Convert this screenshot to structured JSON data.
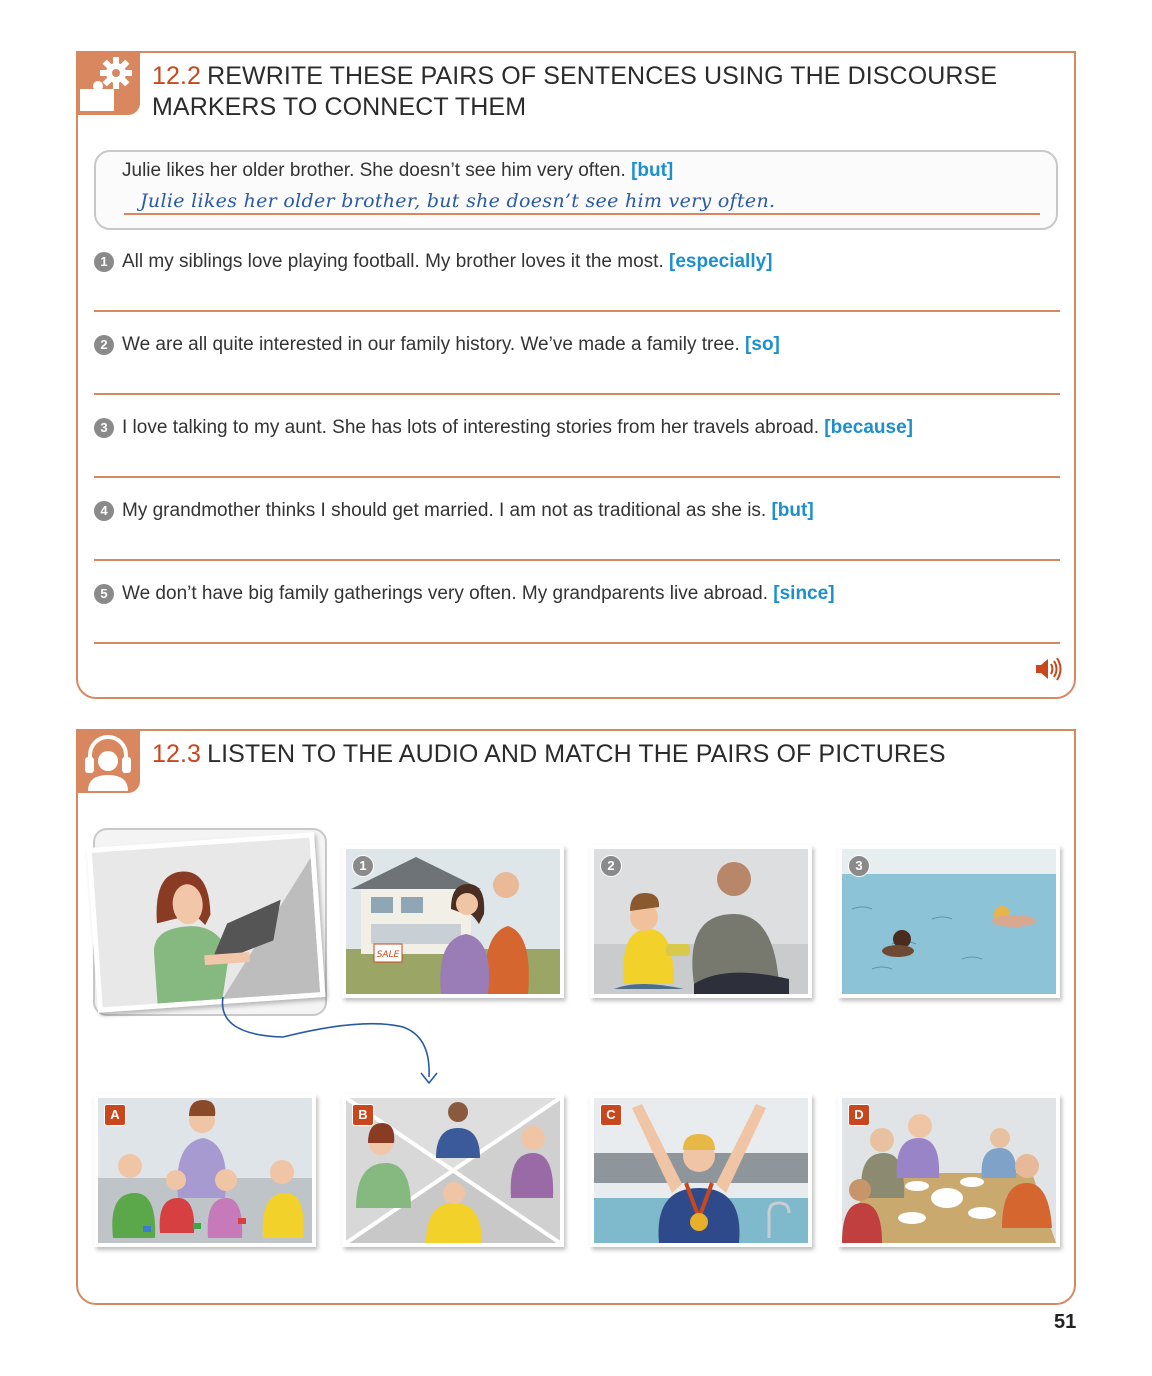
{
  "section_12_2": {
    "number": "12.2",
    "title": "REWRITE THESE PAIRS OF SENTENCES USING THE DISCOURSE MARKERS TO CONNECT THEM",
    "example": {
      "sentence": "Julie likes her older brother. She doesn’t see him very often.",
      "marker": "[but]",
      "answer": "Julie likes her older brother, but she doesn’t see him very often."
    },
    "questions": [
      {
        "number": "1",
        "text": "All my siblings love playing football. My brother loves it the most.",
        "marker": "[especially]"
      },
      {
        "number": "2",
        "text": "We are all quite interested in our family history. We’ve made a family tree.",
        "marker": "[so]"
      },
      {
        "number": "3",
        "text": "I love talking to my aunt. She has lots of interesting stories from her travels abroad.",
        "marker": "[because]"
      },
      {
        "number": "4",
        "text": "My grandmother thinks I should get married. I am not as traditional as she is.",
        "marker": "[but]"
      },
      {
        "number": "5",
        "text": "We don’t have big family gatherings very often. My grandparents live abroad.",
        "marker": "[since]"
      }
    ],
    "audio_icon": "speaker-icon"
  },
  "section_12_3": {
    "number": "12.3",
    "title": "LISTEN TO THE AUDIO AND MATCH THE PAIRS OF PICTURES",
    "top_pictures": [
      {
        "label": "",
        "depicts": "woman-typing-laptop"
      },
      {
        "label": "1",
        "depicts": "couple-house-for-sale"
      },
      {
        "label": "2",
        "depicts": "father-son-toy-car"
      },
      {
        "label": "3",
        "depicts": "people-swimming-pool"
      }
    ],
    "bottom_pictures": [
      {
        "label": "A",
        "depicts": "mother-children-playing"
      },
      {
        "label": "B",
        "depicts": "people-on-laptops"
      },
      {
        "label": "C",
        "depicts": "swimmer-medal-celebrating"
      },
      {
        "label": "D",
        "depicts": "family-dinner-table"
      }
    ],
    "sale_sign": "SALE"
  },
  "page_number": "51",
  "colors": {
    "accent": "#d9875f",
    "heading_number": "#c8471d",
    "marker": "#1c8fcf",
    "handwriting": "#2a5aa6"
  }
}
